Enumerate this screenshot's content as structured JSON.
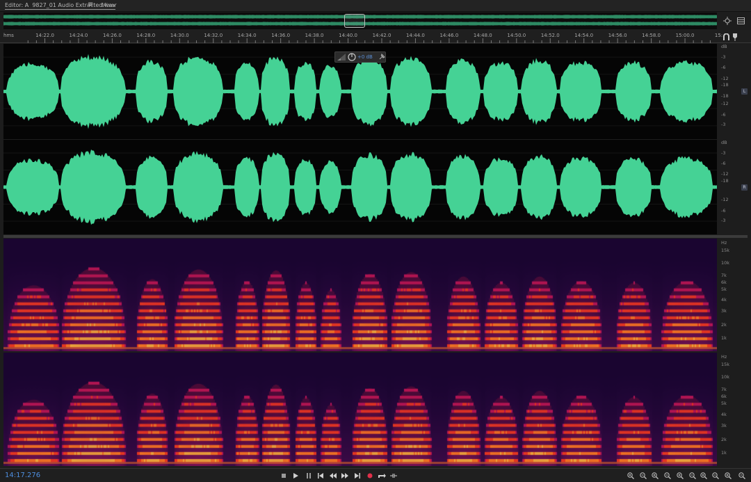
{
  "tabs": {
    "editor_label": "Editor: A",
    "file_name": "9827_01 Audio Extracted.wav",
    "menu_glyph": "≡",
    "mixer_label": "Mixer"
  },
  "ruler": {
    "unit": "hms",
    "ticks": [
      "14:22.0",
      "14:24.0",
      "14:26.0",
      "14:28.0",
      "14:30.0",
      "14:32.0",
      "14:34.0",
      "14:36.0",
      "14:38.0",
      "14:40.0",
      "14:42.0",
      "14:44.0",
      "14:46.0",
      "14:48.0",
      "14:50.0",
      "14:52.0",
      "14:54.0",
      "14:56.0",
      "14:58.0",
      "15:00.0",
      "15:"
    ]
  },
  "waveform": {
    "db_unit": "dB",
    "db_labels_top": [
      "-3",
      "-6",
      "-12",
      "-18"
    ],
    "db_labels_bottom": [
      "-18",
      "-12",
      "-6",
      "-3"
    ],
    "db_labels_r_top": [
      "-3",
      "-6",
      "-12",
      "-18"
    ],
    "db_labels_r_bottom": [
      "-12",
      "-6",
      "-3"
    ],
    "channel_l": "L",
    "channel_r": "R",
    "color": "#45d295",
    "hud_value": "+0 dB"
  },
  "spectral": {
    "hz_unit": "Hz",
    "hz_labels": [
      "15k",
      "10k",
      "7k",
      "6k",
      "5k",
      "4k",
      "3k",
      "2k",
      "1k"
    ]
  },
  "transport": {
    "current_time": "14:17.276"
  },
  "icons": {
    "overview_right": [
      "zoom-tool-icon",
      "panel-toggle-icon"
    ],
    "ruler_right": [
      "snap-icon",
      "marker-icon"
    ],
    "transport": [
      "stop-icon",
      "play-icon",
      "pause-icon",
      "skip-back-icon",
      "rewind-icon",
      "fast-forward-icon",
      "skip-forward-icon",
      "record-icon",
      "loop-icon",
      "skip-selection-icon"
    ],
    "zoom": [
      "zoom-in-amplitude-icon",
      "zoom-out-amplitude-icon",
      "zoom-in-time-icon",
      "zoom-out-time-icon",
      "zoom-full-icon",
      "zoom-selection-icon",
      "zoom-in-left-icon",
      "zoom-in-right-icon",
      "zoom-fit-icon",
      "zoom-undo-icon"
    ]
  }
}
